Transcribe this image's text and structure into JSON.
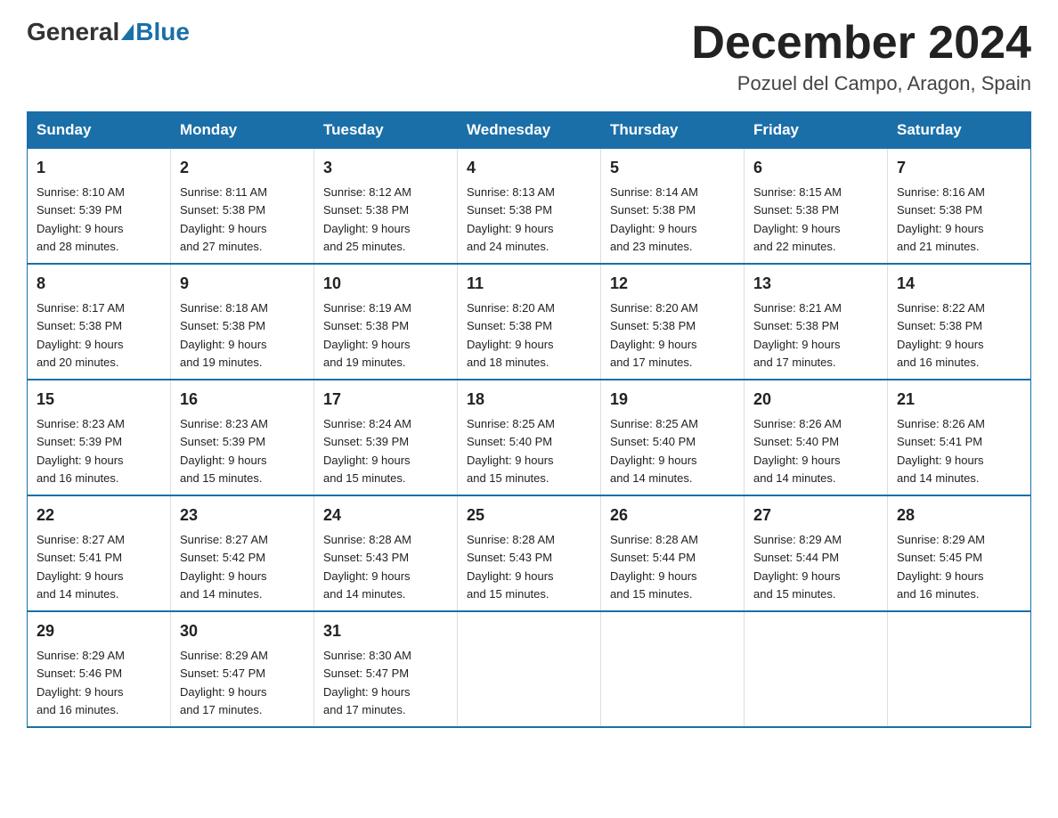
{
  "header": {
    "logo_general": "General",
    "logo_blue": "Blue",
    "title": "December 2024",
    "subtitle": "Pozuel del Campo, Aragon, Spain"
  },
  "days_of_week": [
    "Sunday",
    "Monday",
    "Tuesday",
    "Wednesday",
    "Thursday",
    "Friday",
    "Saturday"
  ],
  "weeks": [
    [
      {
        "day": "1",
        "sunrise": "8:10 AM",
        "sunset": "5:39 PM",
        "daylight": "9 hours and 28 minutes."
      },
      {
        "day": "2",
        "sunrise": "8:11 AM",
        "sunset": "5:38 PM",
        "daylight": "9 hours and 27 minutes."
      },
      {
        "day": "3",
        "sunrise": "8:12 AM",
        "sunset": "5:38 PM",
        "daylight": "9 hours and 25 minutes."
      },
      {
        "day": "4",
        "sunrise": "8:13 AM",
        "sunset": "5:38 PM",
        "daylight": "9 hours and 24 minutes."
      },
      {
        "day": "5",
        "sunrise": "8:14 AM",
        "sunset": "5:38 PM",
        "daylight": "9 hours and 23 minutes."
      },
      {
        "day": "6",
        "sunrise": "8:15 AM",
        "sunset": "5:38 PM",
        "daylight": "9 hours and 22 minutes."
      },
      {
        "day": "7",
        "sunrise": "8:16 AM",
        "sunset": "5:38 PM",
        "daylight": "9 hours and 21 minutes."
      }
    ],
    [
      {
        "day": "8",
        "sunrise": "8:17 AM",
        "sunset": "5:38 PM",
        "daylight": "9 hours and 20 minutes."
      },
      {
        "day": "9",
        "sunrise": "8:18 AM",
        "sunset": "5:38 PM",
        "daylight": "9 hours and 19 minutes."
      },
      {
        "day": "10",
        "sunrise": "8:19 AM",
        "sunset": "5:38 PM",
        "daylight": "9 hours and 19 minutes."
      },
      {
        "day": "11",
        "sunrise": "8:20 AM",
        "sunset": "5:38 PM",
        "daylight": "9 hours and 18 minutes."
      },
      {
        "day": "12",
        "sunrise": "8:20 AM",
        "sunset": "5:38 PM",
        "daylight": "9 hours and 17 minutes."
      },
      {
        "day": "13",
        "sunrise": "8:21 AM",
        "sunset": "5:38 PM",
        "daylight": "9 hours and 17 minutes."
      },
      {
        "day": "14",
        "sunrise": "8:22 AM",
        "sunset": "5:38 PM",
        "daylight": "9 hours and 16 minutes."
      }
    ],
    [
      {
        "day": "15",
        "sunrise": "8:23 AM",
        "sunset": "5:39 PM",
        "daylight": "9 hours and 16 minutes."
      },
      {
        "day": "16",
        "sunrise": "8:23 AM",
        "sunset": "5:39 PM",
        "daylight": "9 hours and 15 minutes."
      },
      {
        "day": "17",
        "sunrise": "8:24 AM",
        "sunset": "5:39 PM",
        "daylight": "9 hours and 15 minutes."
      },
      {
        "day": "18",
        "sunrise": "8:25 AM",
        "sunset": "5:40 PM",
        "daylight": "9 hours and 15 minutes."
      },
      {
        "day": "19",
        "sunrise": "8:25 AM",
        "sunset": "5:40 PM",
        "daylight": "9 hours and 14 minutes."
      },
      {
        "day": "20",
        "sunrise": "8:26 AM",
        "sunset": "5:40 PM",
        "daylight": "9 hours and 14 minutes."
      },
      {
        "day": "21",
        "sunrise": "8:26 AM",
        "sunset": "5:41 PM",
        "daylight": "9 hours and 14 minutes."
      }
    ],
    [
      {
        "day": "22",
        "sunrise": "8:27 AM",
        "sunset": "5:41 PM",
        "daylight": "9 hours and 14 minutes."
      },
      {
        "day": "23",
        "sunrise": "8:27 AM",
        "sunset": "5:42 PM",
        "daylight": "9 hours and 14 minutes."
      },
      {
        "day": "24",
        "sunrise": "8:28 AM",
        "sunset": "5:43 PM",
        "daylight": "9 hours and 14 minutes."
      },
      {
        "day": "25",
        "sunrise": "8:28 AM",
        "sunset": "5:43 PM",
        "daylight": "9 hours and 15 minutes."
      },
      {
        "day": "26",
        "sunrise": "8:28 AM",
        "sunset": "5:44 PM",
        "daylight": "9 hours and 15 minutes."
      },
      {
        "day": "27",
        "sunrise": "8:29 AM",
        "sunset": "5:44 PM",
        "daylight": "9 hours and 15 minutes."
      },
      {
        "day": "28",
        "sunrise": "8:29 AM",
        "sunset": "5:45 PM",
        "daylight": "9 hours and 16 minutes."
      }
    ],
    [
      {
        "day": "29",
        "sunrise": "8:29 AM",
        "sunset": "5:46 PM",
        "daylight": "9 hours and 16 minutes."
      },
      {
        "day": "30",
        "sunrise": "8:29 AM",
        "sunset": "5:47 PM",
        "daylight": "9 hours and 17 minutes."
      },
      {
        "day": "31",
        "sunrise": "8:30 AM",
        "sunset": "5:47 PM",
        "daylight": "9 hours and 17 minutes."
      },
      null,
      null,
      null,
      null
    ]
  ],
  "labels": {
    "sunrise": "Sunrise:",
    "sunset": "Sunset:",
    "daylight": "Daylight:"
  }
}
